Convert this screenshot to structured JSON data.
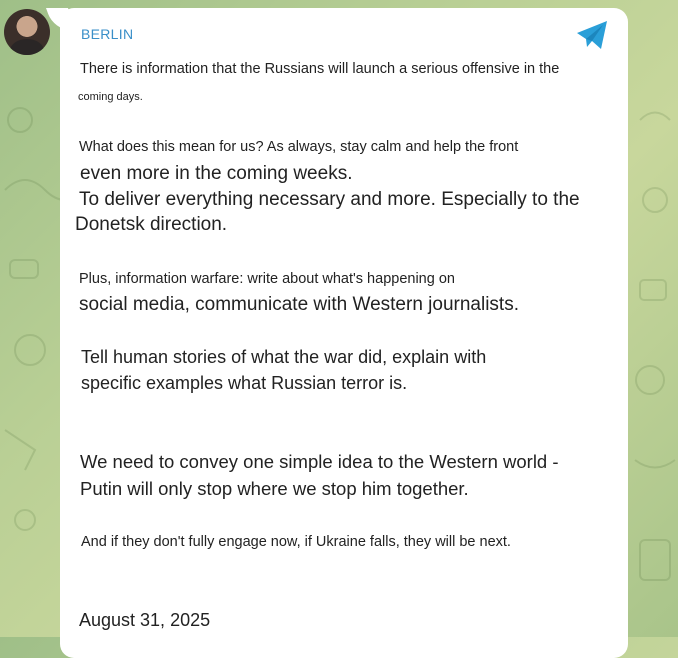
{
  "post": {
    "channel": "BERLIN",
    "lines": [
      "There is information that the Russians will launch a serious offensive in the",
      "coming days.",
      "What does this mean for us? As always, stay calm and help the front",
      "even more in the coming weeks.",
      "To deliver everything necessary and more. Especially to the",
      "Donetsk direction.",
      "Plus, information warfare: write about what's happening on",
      "social media, communicate with Western journalists.",
      "Tell human stories of what the war did, explain with",
      "specific examples what Russian terror is.",
      "We need to convey one simple idea to the Western world -",
      "Putin will only stop where we stop him together.",
      "And if they don't fully engage now, if Ukraine falls, they will be next."
    ],
    "date": "August 31, 2025"
  },
  "icons": {
    "avatar": "user-avatar",
    "app": "telegram-plane-icon"
  },
  "colors": {
    "channel": "#3a8fc8",
    "telegram": "#2a9fd8",
    "bubble": "#ffffff"
  }
}
